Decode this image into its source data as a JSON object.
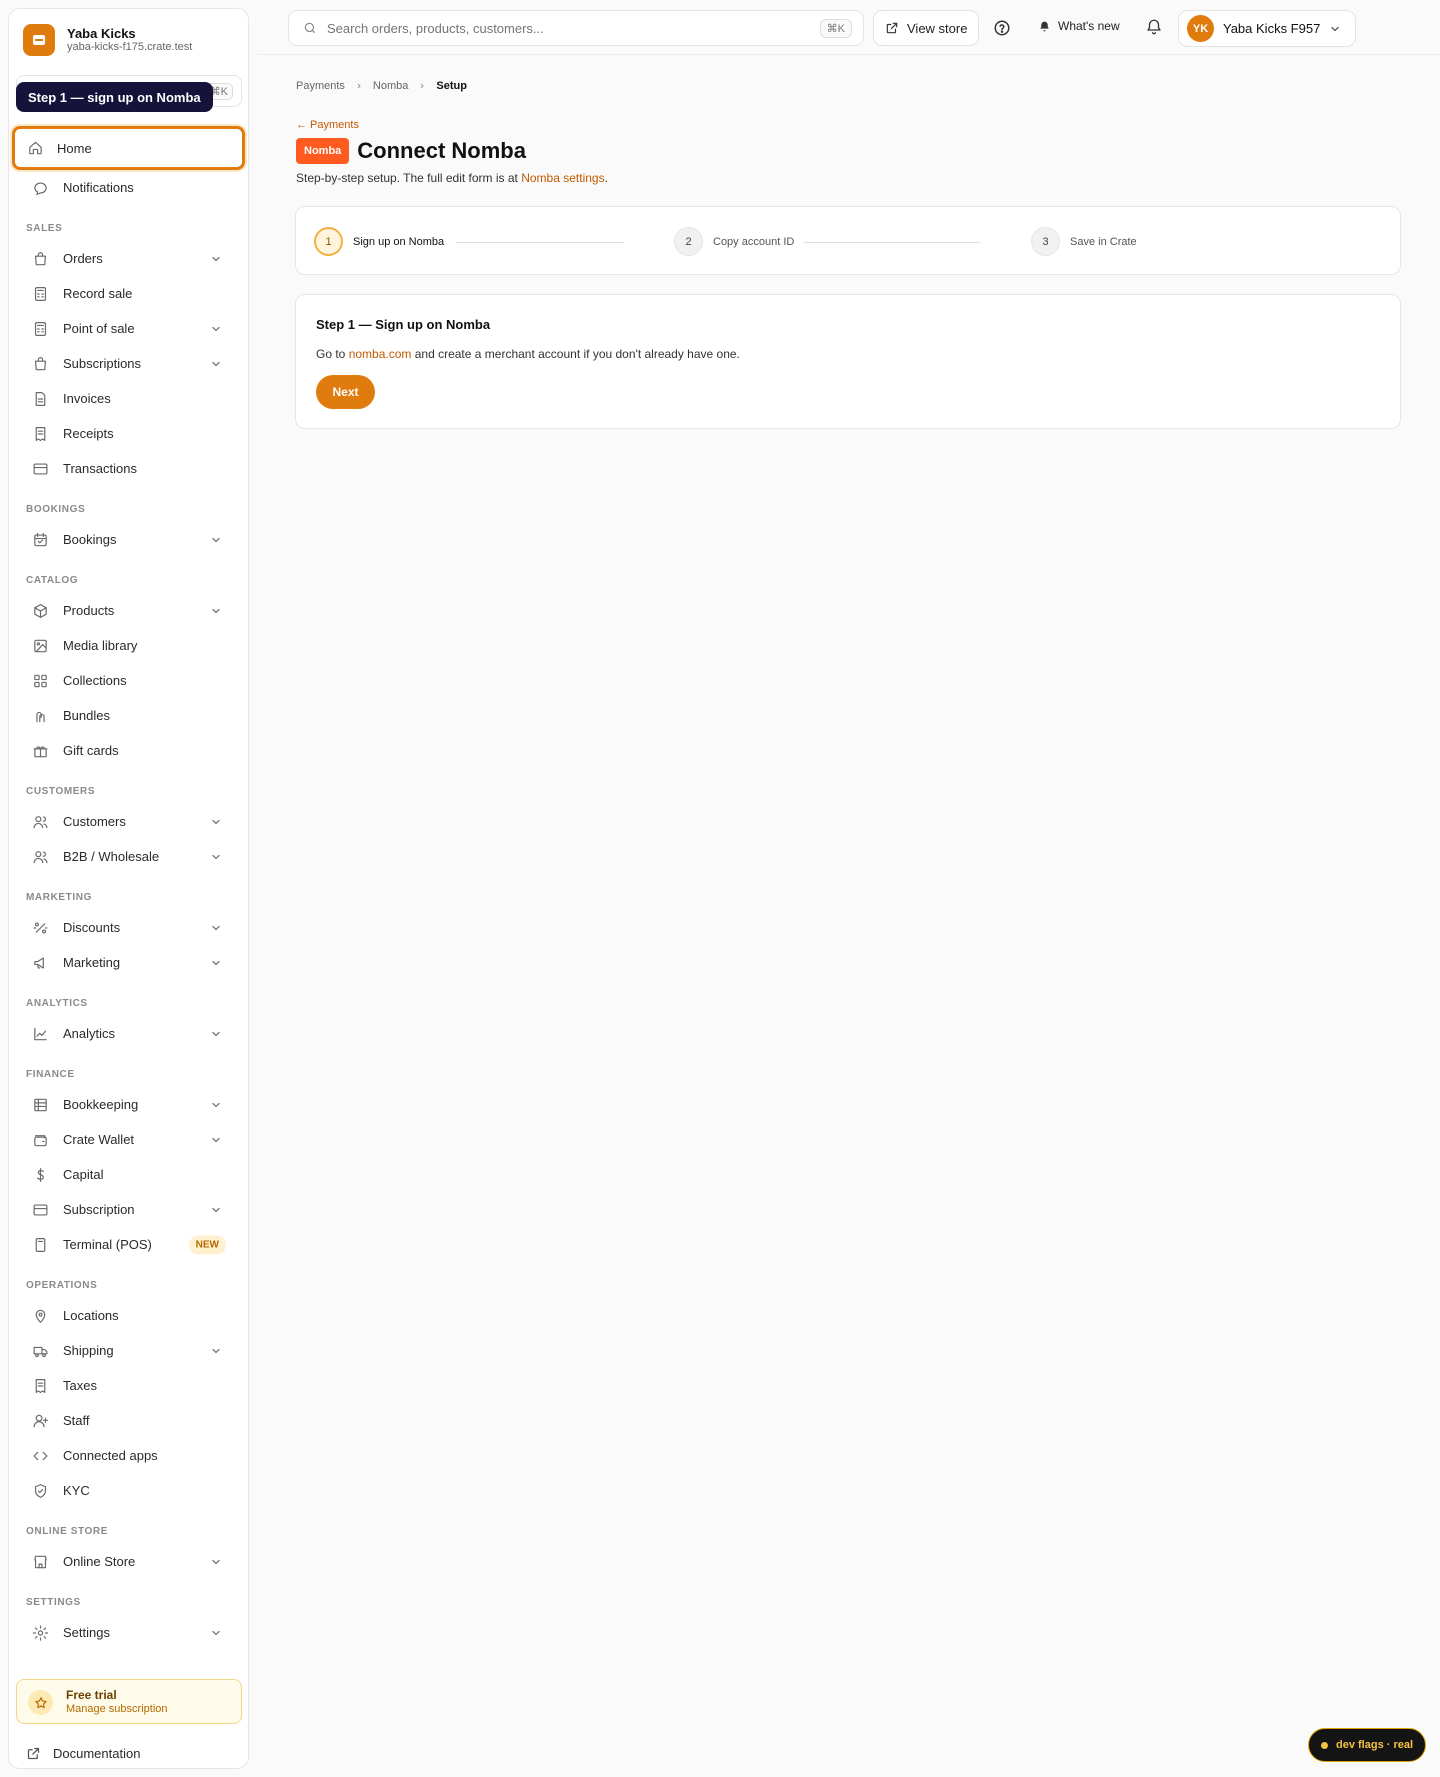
{
  "brand": {
    "name": "Yaba Kicks",
    "domain": "yaba-kicks-f175.crate.test"
  },
  "sidebar_search": {
    "kbd": "⌘K"
  },
  "tooltip": "Step 1 — sign up on Nomba",
  "nav": [
    {
      "type": "item",
      "label": "Home",
      "icon": "home-icon",
      "active": true
    },
    {
      "type": "item",
      "label": "Notifications",
      "icon": "chat-bubble-icon"
    },
    {
      "type": "section",
      "label": "SALES"
    },
    {
      "type": "item",
      "label": "Orders",
      "icon": "bag-icon",
      "chevron": true
    },
    {
      "type": "item",
      "label": "Record sale",
      "icon": "calculator-icon"
    },
    {
      "type": "item",
      "label": "Point of sale",
      "icon": "calculator-icon",
      "chevron": true
    },
    {
      "type": "item",
      "label": "Subscriptions",
      "icon": "bag-icon",
      "chevron": true
    },
    {
      "type": "item",
      "label": "Invoices",
      "icon": "document-icon"
    },
    {
      "type": "item",
      "label": "Receipts",
      "icon": "receipt-icon"
    },
    {
      "type": "item",
      "label": "Transactions",
      "icon": "card-icon"
    },
    {
      "type": "section",
      "label": "BOOKINGS"
    },
    {
      "type": "item",
      "label": "Bookings",
      "icon": "calendar-icon",
      "chevron": true
    },
    {
      "type": "section",
      "label": "CATALOG"
    },
    {
      "type": "item",
      "label": "Products",
      "icon": "box-icon",
      "chevron": true
    },
    {
      "type": "item",
      "label": "Media library",
      "icon": "image-icon"
    },
    {
      "type": "item",
      "label": "Collections",
      "icon": "grid-icon"
    },
    {
      "type": "item",
      "label": "Bundles",
      "icon": "bundle-icon"
    },
    {
      "type": "item",
      "label": "Gift cards",
      "icon": "gift-icon"
    },
    {
      "type": "section",
      "label": "CUSTOMERS"
    },
    {
      "type": "item",
      "label": "Customers",
      "icon": "users-icon",
      "chevron": true
    },
    {
      "type": "item",
      "label": "B2B / Wholesale",
      "icon": "users-icon",
      "chevron": true
    },
    {
      "type": "section",
      "label": "MARKETING"
    },
    {
      "type": "item",
      "label": "Discounts",
      "icon": "discount-icon",
      "chevron": true
    },
    {
      "type": "item",
      "label": "Marketing",
      "icon": "megaphone-icon",
      "chevron": true
    },
    {
      "type": "section",
      "label": "ANALYTICS"
    },
    {
      "type": "item",
      "label": "Analytics",
      "icon": "chart-line-icon",
      "chevron": true
    },
    {
      "type": "section",
      "label": "FINANCE"
    },
    {
      "type": "item",
      "label": "Bookkeeping",
      "icon": "ledger-icon",
      "chevron": true
    },
    {
      "type": "item",
      "label": "Crate Wallet",
      "icon": "wallet-icon",
      "chevron": true
    },
    {
      "type": "item",
      "label": "Capital",
      "icon": "dollar-icon"
    },
    {
      "type": "item",
      "label": "Subscription",
      "icon": "card-icon",
      "chevron": true
    },
    {
      "type": "item",
      "label": "Terminal (POS)",
      "icon": "terminal-icon",
      "badge": "NEW"
    },
    {
      "type": "section",
      "label": "OPERATIONS"
    },
    {
      "type": "item",
      "label": "Locations",
      "icon": "pin-icon"
    },
    {
      "type": "item",
      "label": "Shipping",
      "icon": "truck-icon",
      "chevron": true
    },
    {
      "type": "item",
      "label": "Taxes",
      "icon": "receipt-icon"
    },
    {
      "type": "item",
      "label": "Staff",
      "icon": "user-plus-icon"
    },
    {
      "type": "item",
      "label": "Connected apps",
      "icon": "code-icon"
    },
    {
      "type": "item",
      "label": "KYC",
      "icon": "shield-icon"
    },
    {
      "type": "section",
      "label": "ONLINE STORE"
    },
    {
      "type": "item",
      "label": "Online Store",
      "icon": "store-icon",
      "chevron": true
    },
    {
      "type": "section",
      "label": "SETTINGS"
    },
    {
      "type": "item",
      "label": "Settings",
      "icon": "gear-icon",
      "chevron": true
    }
  ],
  "trial": {
    "title": "Free trial",
    "link": "Manage subscription"
  },
  "docs": {
    "label": "Documentation"
  },
  "topbar": {
    "search_placeholder": "Search orders, products, customers...",
    "search_kbd": "⌘K",
    "view_store": "View store",
    "whats_new": "What's new",
    "account_initials": "YK",
    "account_name": "Yaba Kicks F957"
  },
  "breadcrumb": [
    "Payments",
    "Nomba",
    "Setup"
  ],
  "back_link": "← Payments",
  "header": {
    "badge": "Nomba",
    "title": "Connect Nomba",
    "subtitle_pre": "Step-by-step setup. The full edit form is at ",
    "subtitle_link": "Nomba settings",
    "subtitle_post": "."
  },
  "steps": [
    {
      "num": "1",
      "label": "Sign up on Nomba",
      "active": true
    },
    {
      "num": "2",
      "label": "Copy account ID",
      "active": false
    },
    {
      "num": "3",
      "label": "Save in Crate",
      "active": false
    }
  ],
  "card": {
    "title": "Step 1 — Sign up on Nomba",
    "text_pre": "Go to ",
    "text_link": "nomba.com",
    "text_post": " and create a merchant account if you don't already have one.",
    "button": "Next"
  },
  "dev_flags": "dev flags · real",
  "colors": {
    "accent": "#e07b0e",
    "nomba": "#ff5a1f",
    "link": "#c25b00"
  }
}
